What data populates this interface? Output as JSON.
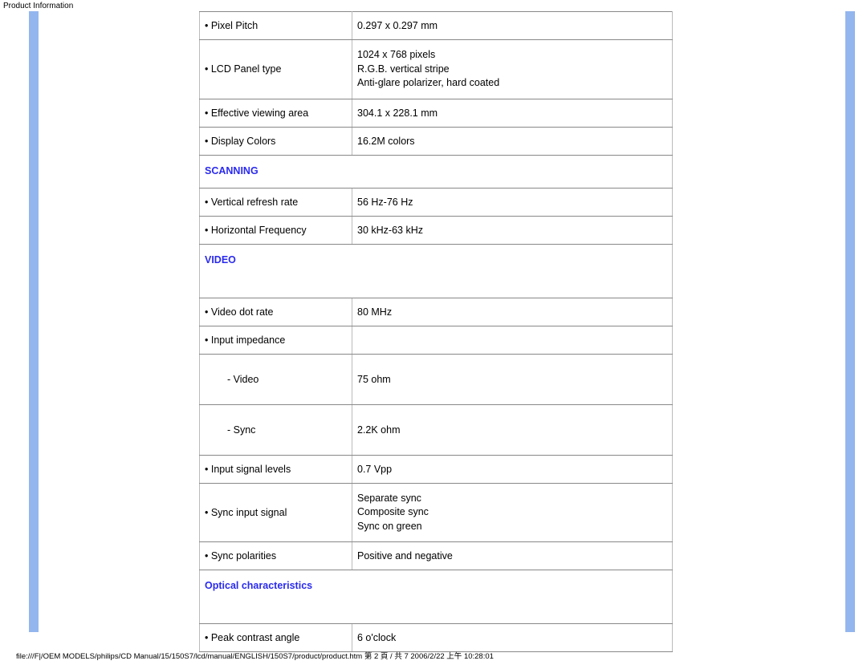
{
  "page_title": "Product Information",
  "footer": "file:///F|/OEM MODELS/philips/CD Manual/15/150S7/lcd/manual/ENGLISH/150S7/product/product.htm 第 2 頁 / 共 7 2006/2/22 上午 10:28:01",
  "sections": {
    "panel": {
      "rows": {
        "pixel_pitch": {
          "label": "• Pixel Pitch",
          "value": "0.297 x 0.297 mm"
        },
        "lcd_type": {
          "label": "• LCD Panel type",
          "value": "1024 x 768 pixels\nR.G.B. vertical stripe\nAnti-glare polarizer, hard coated"
        },
        "eff_area": {
          "label": "• Effective viewing area",
          "value": "304.1 x 228.1 mm"
        },
        "colors": {
          "label": "• Display Colors",
          "value": "16.2M colors"
        }
      }
    },
    "scanning": {
      "heading": "SCANNING",
      "rows": {
        "vref": {
          "label": "• Vertical refresh rate",
          "value": "56 Hz-76 Hz"
        },
        "hfreq": {
          "label": "• Horizontal Frequency",
          "value": "30 kHz-63 kHz"
        }
      }
    },
    "video": {
      "heading": "VIDEO",
      "rows": {
        "dotrate": {
          "label": "• Video dot rate",
          "value": "80 MHz"
        },
        "inimp": {
          "label": "• Input impedance",
          "value": ""
        },
        "inimp_video": {
          "label": "- Video",
          "value": "75 ohm"
        },
        "inimp_sync": {
          "label": "- Sync",
          "value": "2.2K ohm"
        },
        "siglvl": {
          "label": "• Input signal levels",
          "value": "0.7 Vpp"
        },
        "syncin": {
          "label": "• Sync input signal",
          "value": "Separate sync\nComposite sync\nSync on green"
        },
        "syncpol": {
          "label": "• Sync polarities",
          "value": "Positive and negative"
        }
      }
    },
    "optical": {
      "heading": "Optical characteristics",
      "rows": {
        "peak": {
          "label": "• Peak contrast angle",
          "value": "6 o'clock"
        }
      }
    }
  }
}
